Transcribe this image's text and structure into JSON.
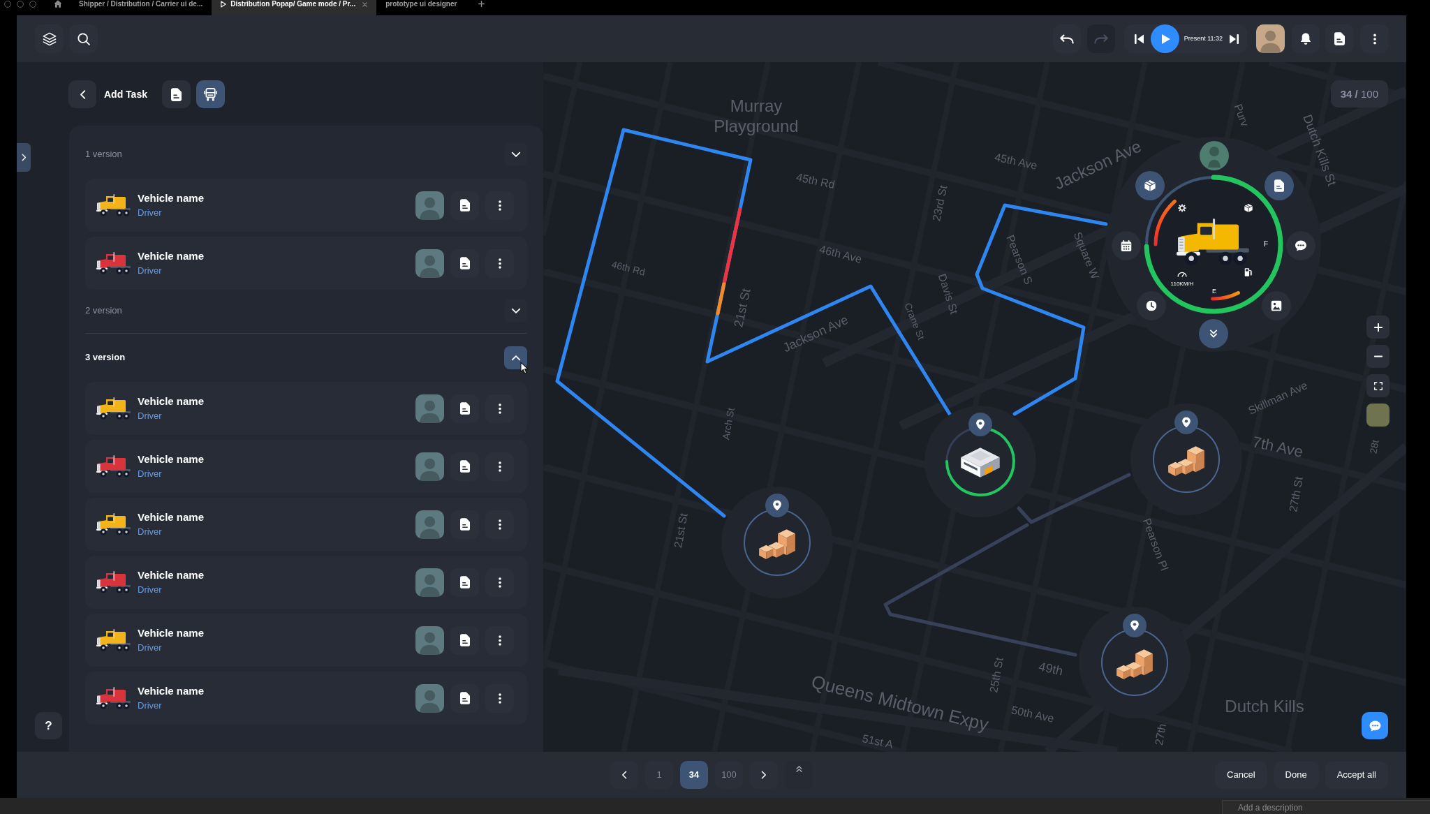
{
  "browser": {
    "tabs": [
      {
        "title": "Shipper / Distribution / Carrier ui de...",
        "kind": "page",
        "selected": false
      },
      {
        "title": "Distribution Popap/ Game mode / Pr...",
        "kind": "prototype",
        "selected": true
      },
      {
        "title": "prototype ui designer",
        "kind": "page",
        "selected": false
      }
    ]
  },
  "toolbar": {
    "undo": {
      "disabled": false
    },
    "redo": {
      "disabled": true
    },
    "player": {
      "label": "Present 11:32"
    }
  },
  "task_panel": {
    "title": "Add Task",
    "views": [
      {
        "kind": "document",
        "selected": false
      },
      {
        "kind": "truck",
        "selected": true
      }
    ],
    "versions": [
      {
        "label": "1 version",
        "selected": false,
        "expanded": false,
        "vehicles": [
          {
            "name": "Vehicle name",
            "role": "Driver",
            "color": "#f2b418"
          },
          {
            "name": "Vehicle name",
            "role": "Driver",
            "color": "#d8343c"
          }
        ]
      },
      {
        "label": "2 version",
        "selected": false,
        "expanded": false
      },
      {
        "label": "3 version",
        "selected": true,
        "expanded": true,
        "vehicles": [
          {
            "name": "Vehicle name",
            "role": "Driver",
            "color": "#f2b418"
          },
          {
            "name": "Vehicle name",
            "role": "Driver",
            "color": "#d8343c"
          },
          {
            "name": "Vehicle name",
            "role": "Driver",
            "color": "#f2b418"
          },
          {
            "name": "Vehicle name",
            "role": "Driver",
            "color": "#d8343c"
          },
          {
            "name": "Vehicle name",
            "role": "Driver",
            "color": "#f2b418"
          },
          {
            "name": "Vehicle name",
            "role": "Driver",
            "color": "#d8343c"
          }
        ]
      }
    ]
  },
  "help": {
    "label": "?"
  },
  "map": {
    "counter": "**34 /** 100",
    "place_label": {
      "lines": [
        "Murray",
        "Playground"
      ]
    },
    "street_labels": [
      {
        "text": "Purv"
      },
      {
        "text": "Dutch Kills St"
      },
      {
        "text": "45th Ave"
      },
      {
        "text": "Jackson Ave"
      },
      {
        "text": "45th Rd"
      },
      {
        "text": "23rd St"
      },
      {
        "text": "Square W"
      },
      {
        "text": "46th Ave"
      },
      {
        "text": "46th Rd"
      },
      {
        "text": "Pearson S"
      },
      {
        "text": "Davis St"
      },
      {
        "text": "21st St"
      },
      {
        "text": "Jackson Ave"
      },
      {
        "text": "Crane St"
      },
      {
        "text": "Skillman Ave"
      },
      {
        "text": "Arch St"
      },
      {
        "text": "28t"
      },
      {
        "text": "7th Ave"
      },
      {
        "text": "27th St"
      },
      {
        "text": "21st St"
      },
      {
        "text": "Pearson Pl"
      },
      {
        "text": "49th"
      },
      {
        "text": "25th St"
      },
      {
        "text": "Queens Midtown Expy"
      },
      {
        "text": "Dutch Kills"
      },
      {
        "text": "50th Ave"
      },
      {
        "text": "27th"
      },
      {
        "text": "51st A"
      }
    ],
    "widget": {
      "speed": "110KM/H",
      "fuel_full": "F",
      "fuel_empty": "E"
    },
    "stops": [
      {
        "kind": "boxes"
      },
      {
        "kind": "warehouse"
      },
      {
        "kind": "boxes"
      },
      {
        "kind": "boxes"
      }
    ]
  },
  "pager": {
    "pages": [
      {
        "label": "1",
        "selected": false
      },
      {
        "label": "34",
        "selected": true
      },
      {
        "label": "100",
        "selected": false
      }
    ]
  },
  "actions": [
    {
      "label": "Cancel"
    },
    {
      "label": "Done"
    },
    {
      "label": "Accept all"
    }
  ],
  "description": {
    "placeholder": "Add a description"
  }
}
